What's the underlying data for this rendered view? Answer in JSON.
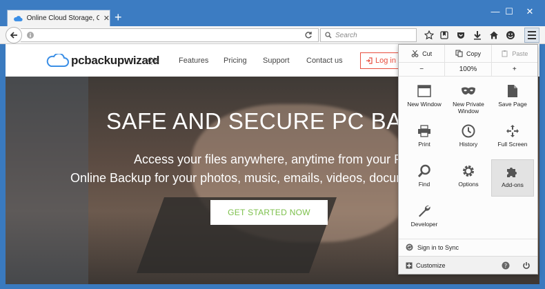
{
  "browser": {
    "tab_title": "Online Cloud Storage, Co...",
    "new_tab_label": "+",
    "search_placeholder": "Search",
    "accent_color": "#3c7cc2"
  },
  "site": {
    "logo_text": "pcbackupwizard",
    "nav": [
      "Q's",
      "Features",
      "Pricing",
      "Support",
      "Contact us"
    ],
    "login_label": "Log in",
    "hero_title": "SAFE AND SECURE PC BACK",
    "hero_line1": "Access your files anywhere, anytime from your PC",
    "hero_line2": "Online Backup for your photos, music, emails, videos, docume",
    "cta_label": "GET STARTED NOW"
  },
  "menu": {
    "edit": {
      "cut": "Cut",
      "copy": "Copy",
      "paste": "Paste"
    },
    "zoom": {
      "minus": "−",
      "value": "100%",
      "plus": "+"
    },
    "items": [
      {
        "label": "New Window",
        "icon": "new-window-icon"
      },
      {
        "label": "New Private Window",
        "icon": "private-mask-icon"
      },
      {
        "label": "Save Page",
        "icon": "save-page-icon"
      },
      {
        "label": "Print",
        "icon": "print-icon"
      },
      {
        "label": "History",
        "icon": "history-clock-icon"
      },
      {
        "label": "Full Screen",
        "icon": "full-screen-icon"
      },
      {
        "label": "Find",
        "icon": "find-magnifier-icon"
      },
      {
        "label": "Options",
        "icon": "options-gear-icon"
      },
      {
        "label": "Add-ons",
        "icon": "addons-puzzle-icon"
      },
      {
        "label": "Developer",
        "icon": "developer-wrench-icon"
      }
    ],
    "sign_in": "Sign in to Sync",
    "customize": "Customize"
  }
}
